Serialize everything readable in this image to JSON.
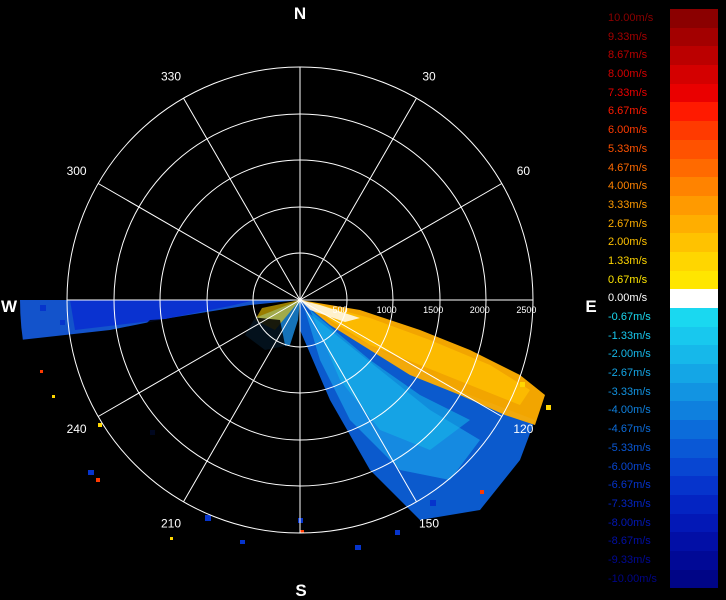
{
  "compass": {
    "north": "N",
    "east": "E",
    "south": "S",
    "west": "W"
  },
  "bearings": [
    {
      "label": "30",
      "deg": 30
    },
    {
      "label": "60",
      "deg": 60
    },
    {
      "label": "120",
      "deg": 120
    },
    {
      "label": "150",
      "deg": 150
    },
    {
      "label": "210",
      "deg": 210
    },
    {
      "label": "240",
      "deg": 240
    },
    {
      "label": "300",
      "deg": 300
    },
    {
      "label": "330",
      "deg": 330
    }
  ],
  "range_labels": [
    "500",
    "1000",
    "1500",
    "2000",
    "2500"
  ],
  "legend": [
    {
      "label": "10.00m/s",
      "color": "#8b0000"
    },
    {
      "label": "9.33m/s",
      "color": "#a30000"
    },
    {
      "label": "8.67m/s",
      "color": "#bb0000"
    },
    {
      "label": "8.00m/s",
      "color": "#d40000"
    },
    {
      "label": "7.33m/s",
      "color": "#ea0000"
    },
    {
      "label": "6.67m/s",
      "color": "#ff1a00"
    },
    {
      "label": "6.00m/s",
      "color": "#ff3a00"
    },
    {
      "label": "5.33m/s",
      "color": "#ff5200"
    },
    {
      "label": "4.67m/s",
      "color": "#ff6a00"
    },
    {
      "label": "4.00m/s",
      "color": "#ff8300"
    },
    {
      "label": "3.33m/s",
      "color": "#ff9a00"
    },
    {
      "label": "2.67m/s",
      "color": "#ffae00"
    },
    {
      "label": "2.00m/s",
      "color": "#ffc200"
    },
    {
      "label": "1.33m/s",
      "color": "#ffd600"
    },
    {
      "label": "0.67m/s",
      "color": "#ffe600"
    },
    {
      "label": "0.00m/s",
      "color": "#ffffff"
    },
    {
      "label": "-0.67m/s",
      "color": "#1ad8f0"
    },
    {
      "label": "-1.33m/s",
      "color": "#18c8ee"
    },
    {
      "label": "-2.00m/s",
      "color": "#16b8ea"
    },
    {
      "label": "-2.67m/s",
      "color": "#14a6e6"
    },
    {
      "label": "-3.33m/s",
      "color": "#1294e2"
    },
    {
      "label": "-4.00m/s",
      "color": "#0f80de"
    },
    {
      "label": "-4.67m/s",
      "color": "#0c6cda"
    },
    {
      "label": "-5.33m/s",
      "color": "#0a58d6"
    },
    {
      "label": "-6.00m/s",
      "color": "#0846d2"
    },
    {
      "label": "-6.67m/s",
      "color": "#0634cc"
    },
    {
      "label": "-7.33m/s",
      "color": "#0424c2"
    },
    {
      "label": "-8.00m/s",
      "color": "#0318b6"
    },
    {
      "label": "-8.67m/s",
      "color": "#020fa6"
    },
    {
      "label": "-9.33m/s",
      "color": "#010996"
    },
    {
      "label": "-10.00m/s",
      "color": "#000586"
    }
  ]
}
